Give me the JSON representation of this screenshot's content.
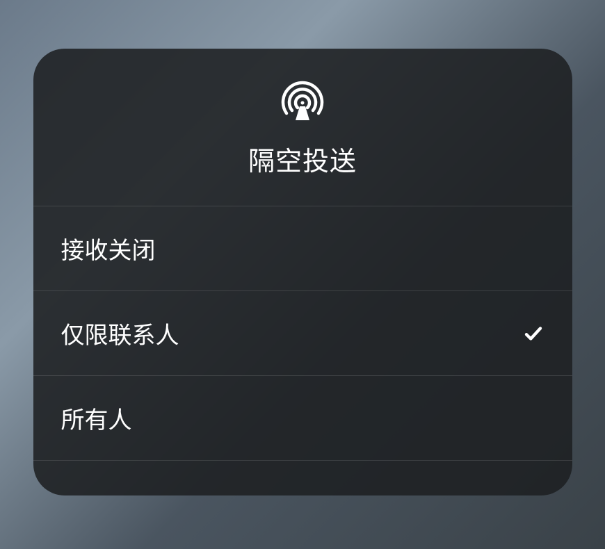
{
  "panel": {
    "title": "隔空投送",
    "icon_name": "airdrop-icon",
    "options": [
      {
        "label": "接收关闭",
        "selected": false
      },
      {
        "label": "仅限联系人",
        "selected": true
      },
      {
        "label": "所有人",
        "selected": false
      }
    ]
  }
}
